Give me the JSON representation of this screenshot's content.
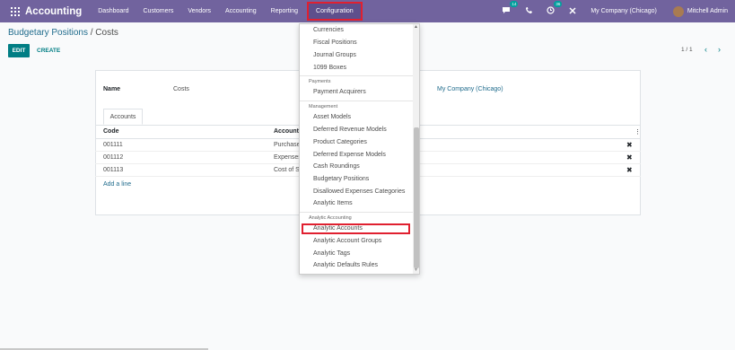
{
  "navbar": {
    "app_title": "Accounting",
    "menu": [
      {
        "label": "Dashboard"
      },
      {
        "label": "Customers"
      },
      {
        "label": "Vendors"
      },
      {
        "label": "Accounting"
      },
      {
        "label": "Reporting"
      },
      {
        "label": "Configuration"
      }
    ],
    "messages_badge": "14",
    "activities_badge": "36",
    "company": "My Company (Chicago)",
    "user": "Mitchell Admin"
  },
  "breadcrumb": {
    "parent": "Budgetary Positions",
    "separator": " / ",
    "current": "Costs"
  },
  "buttons": {
    "edit": "EDIT",
    "create": "CREATE"
  },
  "pager": {
    "value": "1 / 1",
    "prev": "‹",
    "next": "›"
  },
  "form": {
    "name_label": "Name",
    "name_value": "Costs",
    "company_value": "My Company (Chicago)",
    "tab_label": "Accounts",
    "columns": {
      "code": "Code",
      "account": "Account"
    },
    "rows": [
      {
        "code": "001111",
        "account": "Purchase"
      },
      {
        "code": "001112",
        "account": "Expenses"
      },
      {
        "code": "001113",
        "account": "Cost of S"
      }
    ],
    "add_line": "Add a line"
  },
  "dropdown": {
    "items_top": [
      "Currencies",
      "Fiscal Positions",
      "Journal Groups",
      "1099 Boxes"
    ],
    "payments_header": "Payments",
    "payments_items": [
      "Payment Acquirers"
    ],
    "management_header": "Management",
    "management_items": [
      "Asset Models",
      "Deferred Revenue Models",
      "Product Categories",
      "Deferred Expense Models",
      "Cash Roundings",
      "Budgetary Positions",
      "Disallowed Expenses Categories",
      "Analytic Items"
    ],
    "analytic_header": "Analytic Accounting",
    "analytic_items": [
      "Analytic Accounts",
      "Analytic Account Groups",
      "Analytic Tags",
      "Analytic Defaults Rules"
    ]
  },
  "colors": {
    "navbar": "#71639e",
    "primary": "#017e84",
    "link": "#1f6b8c",
    "highlight": "#e02030"
  }
}
